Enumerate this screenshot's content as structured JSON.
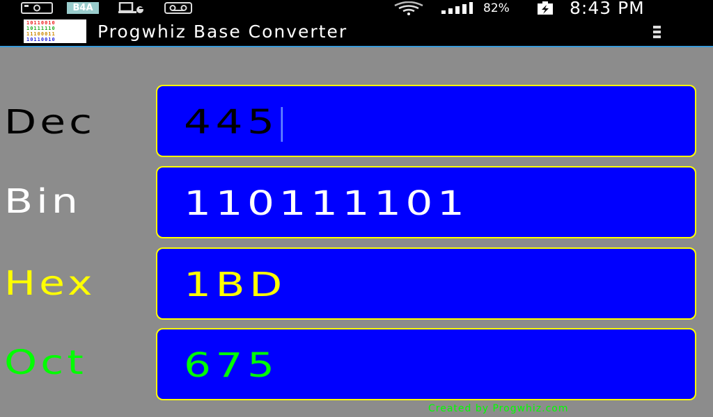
{
  "statusbar": {
    "app_badge": "B4A",
    "battery_percent": "82%",
    "time": "8:43 PM"
  },
  "app": {
    "title": "Progwhiz Base Converter",
    "logo_lines": [
      "10110010",
      "10111110",
      "11100011",
      "10110010"
    ]
  },
  "rows": [
    {
      "label": "Dec",
      "value": "445",
      "label_color": "#000000",
      "value_color": "#000000"
    },
    {
      "label": "Bin",
      "value": "110111101",
      "label_color": "#ffffff",
      "value_color": "#ffffff"
    },
    {
      "label": "Hex",
      "value": "1BD",
      "label_color": "#ffff00",
      "value_color": "#ffff00"
    },
    {
      "label": "Oct",
      "value": "675",
      "label_color": "#00ff00",
      "value_color": "#00ff00"
    }
  ],
  "footer": {
    "credit": "Created by Progwhiz.com"
  },
  "colors": {
    "background": "#8c8c8c",
    "field_fill": "#0000ff",
    "field_border": "#ffff00",
    "appbar_underline": "#3a9ad9"
  },
  "icons": {
    "status_left": [
      "photo-notification-icon",
      "b4a-badge-icon",
      "usb-debug-icon",
      "voicemail-icon"
    ],
    "status_right": [
      "wifi-icon",
      "signal-icon",
      "battery-charging-icon"
    ],
    "overflow": "overflow-menu-icon"
  }
}
